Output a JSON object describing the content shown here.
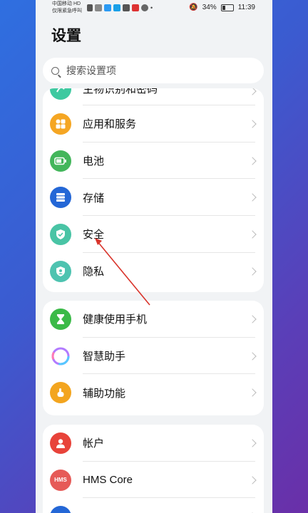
{
  "status_bar": {
    "carrier_line1": "中国移动 HD",
    "carrier_line2": "仅限紧急呼叫",
    "battery_text": "34%",
    "battery_level": 0.34,
    "time": "11:39"
  },
  "page": {
    "title": "设置"
  },
  "search": {
    "placeholder": "搜索设置项"
  },
  "group1": {
    "items": [
      {
        "label": "生物识别和密码",
        "icon": "fingerprint-icon",
        "color": "#3ec9a0"
      },
      {
        "label": "应用和服务",
        "icon": "apps-grid-icon",
        "color": "#f5a623"
      },
      {
        "label": "电池",
        "icon": "battery-icon",
        "color": "#43b65b"
      },
      {
        "label": "存储",
        "icon": "storage-icon",
        "color": "#2467d6"
      },
      {
        "label": "安全",
        "icon": "shield-check-icon",
        "color": "#49c4a5"
      },
      {
        "label": "隐私",
        "icon": "privacy-shield-icon",
        "color": "#4ec3b0"
      }
    ]
  },
  "group2": {
    "items": [
      {
        "label": "健康使用手机",
        "icon": "hourglass-icon",
        "color": "#3bba48"
      },
      {
        "label": "智慧助手",
        "icon": "assistant-ring-icon",
        "color": "#b27bff"
      },
      {
        "label": "辅助功能",
        "icon": "hand-icon",
        "color": "#f3a51f"
      }
    ]
  },
  "group3": {
    "items": [
      {
        "label": "帐户",
        "icon": "user-icon",
        "color": "#e8433a"
      },
      {
        "label": "HMS Core",
        "icon": "hms-icon",
        "color": "#e65a57",
        "icon_text": "HMS"
      },
      {
        "label": "",
        "icon": "blue-icon",
        "color": "#2467d6"
      }
    ]
  }
}
